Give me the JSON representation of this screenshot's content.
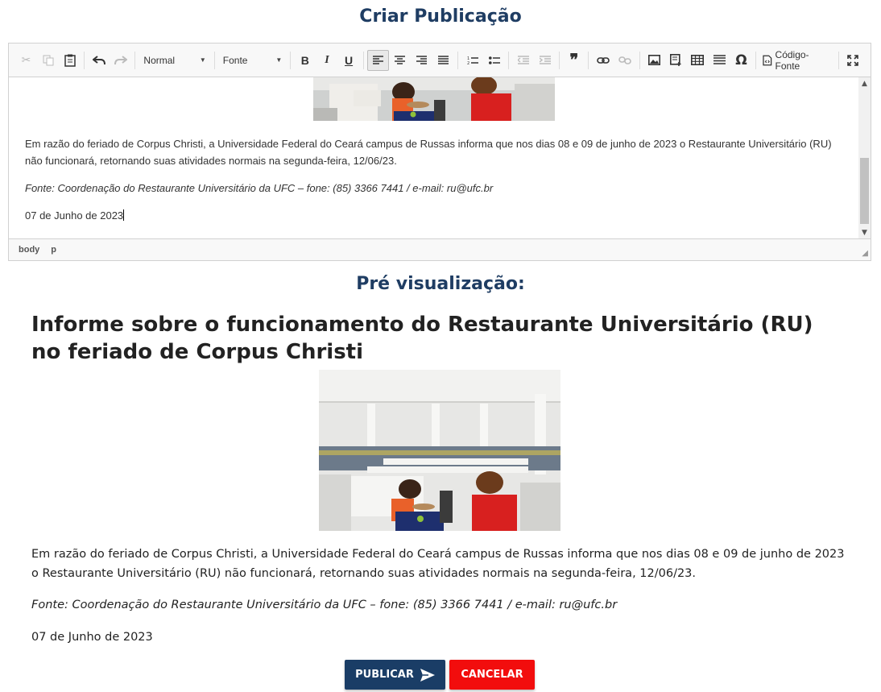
{
  "page": {
    "title": "Criar Publicação",
    "preview_title": "Pré visualização:"
  },
  "toolbar": {
    "format_combo": "Normal",
    "font_combo": "Fonte",
    "source_label": "Código-Fonte",
    "icons": [
      "cut-icon",
      "copy-icon",
      "paste-icon",
      "undo-icon",
      "redo-icon",
      "bold-icon",
      "italic-icon",
      "underline-icon",
      "align-left-icon",
      "align-center-icon",
      "align-right-icon",
      "justify-icon",
      "numbered-list-icon",
      "bulleted-list-icon",
      "outdent-icon",
      "indent-icon",
      "blockquote-icon",
      "link-icon",
      "unlink-icon",
      "image-icon",
      "iframe-icon",
      "table-icon",
      "horizontal-rule-icon",
      "special-char-icon",
      "source-icon",
      "maximize-icon"
    ]
  },
  "editor": {
    "paragraph": "Em razão do feriado de Corpus Christi, a Universidade Federal do Ceará campus de Russas informa que nos dias 08 e 09 de junho de 2023 o Restaurante Universitário (RU) não funcionará, retornando suas atividades normais na segunda-feira, 12/06/23.",
    "source": "Fonte: Coordenação do Restaurante Universitário da UFC – fone: (85) 3366 7441 / e-mail: ru@ufc.br",
    "date": "07 de Junho de 2023",
    "path_body": "body",
    "path_p": "p"
  },
  "article": {
    "title": "Informe sobre o funcionamento do Restaurante Universitário (RU) no feriado de Corpus Christi",
    "paragraph": "Em razão do feriado de Corpus Christi, a Universidade Federal do Ceará campus de Russas informa que nos dias 08 e 09 de junho de 2023 o Restaurante Universitário (RU) não funcionará, retornando suas atividades normais na segunda-feira, 12/06/23.",
    "source": "Fonte: Coordenação do Restaurante Universitário da UFC – fone: (85) 3366 7441 / e-mail: ru@ufc.br",
    "date": "07 de Junho de 2023"
  },
  "actions": {
    "publish_label": "PUBLICAR",
    "cancel_label": "CANCELAR"
  },
  "colors": {
    "heading": "#1f3d63",
    "publish": "#1a3d66",
    "cancel": "#f20d0d"
  }
}
